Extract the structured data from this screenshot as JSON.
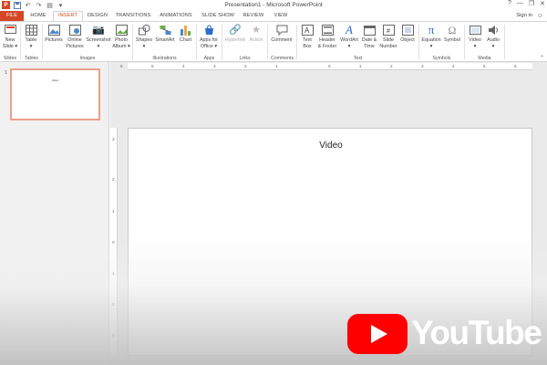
{
  "app": {
    "window_title": "Presentation1 - Microsoft PowerPoint",
    "brand_color": "#d24726",
    "quick_access": [
      "save-icon",
      "undo-icon",
      "redo-icon",
      "start-from-beginning-icon",
      "customize-icon"
    ],
    "window_controls": [
      "?",
      "—",
      "❐",
      "✕"
    ]
  },
  "tabs": {
    "items": [
      "FILE",
      "HOME",
      "INSERT",
      "DESIGN",
      "TRANSITIONS",
      "ANIMATIONS",
      "SLIDE SHOW",
      "REVIEW",
      "VIEW"
    ],
    "active": "INSERT",
    "sign_in": "Sign in"
  },
  "ribbon": {
    "new_slide": [
      "New",
      "Slide ▾"
    ],
    "table": [
      "Table",
      "▾"
    ],
    "pictures": [
      "Pictures",
      ""
    ],
    "online_pictures": [
      "Online",
      "Pictures"
    ],
    "screenshot": [
      "Screenshot",
      "▾"
    ],
    "photo_album": [
      "Photo",
      "Album ▾"
    ],
    "shapes": [
      "Shapes",
      "▾"
    ],
    "smartart": [
      "SmartArt",
      ""
    ],
    "chart": [
      "Chart",
      ""
    ],
    "apps_for_office": [
      "Apps for",
      "Office ▾"
    ],
    "hyperlink": [
      "Hyperlink",
      ""
    ],
    "action": [
      "Action",
      ""
    ],
    "comment": [
      "Comment",
      ""
    ],
    "text_box": [
      "Text",
      "Box"
    ],
    "header_footer": [
      "Header",
      "& Footer"
    ],
    "wordart": [
      "WordArt",
      "▾"
    ],
    "date_time": [
      "Date &",
      "Time"
    ],
    "slide_number": [
      "Slide",
      "Number"
    ],
    "object": [
      "Object",
      ""
    ],
    "equation": [
      "Equation",
      "▾"
    ],
    "symbol": [
      "Symbol",
      ""
    ],
    "video": [
      "Video",
      "▾"
    ],
    "audio": [
      "Audio",
      "▾"
    ],
    "groups": {
      "slides": "Slides",
      "tables": "Tables",
      "images": "Images",
      "illustrations": "Illustrations",
      "apps": "Apps",
      "links": "Links",
      "comments": "Comments",
      "text": "Text",
      "symbols": "Symbols",
      "media": "Media"
    }
  },
  "thumbnails": [
    {
      "number": "1",
      "title": "Video"
    }
  ],
  "ruler": {
    "horizontal": [
      "6",
      "5",
      "4",
      "3",
      "2",
      "1",
      "0",
      "1",
      "2",
      "3",
      "4",
      "5",
      "6"
    ],
    "vertical": [
      "3",
      "2",
      "1",
      "0",
      "1",
      "2",
      "3"
    ]
  },
  "slide": {
    "title": "Video"
  },
  "overlay": {
    "logo_text": "YouTube",
    "logo_color": "#ff0000"
  }
}
